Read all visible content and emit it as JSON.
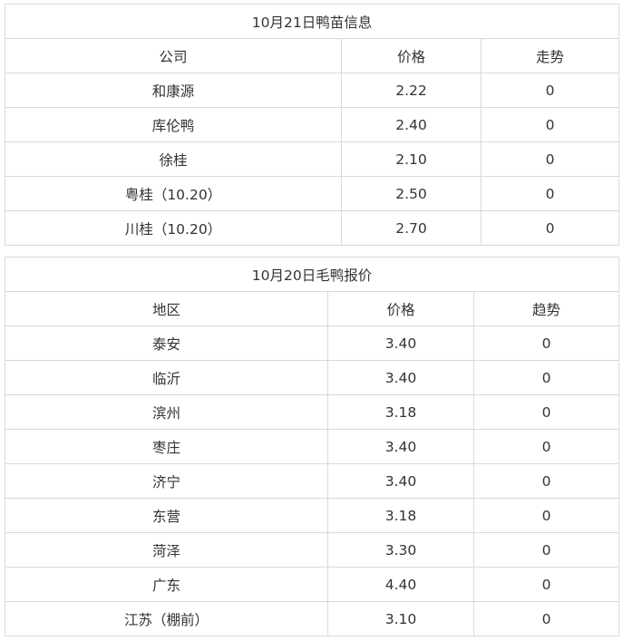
{
  "duckling_table": {
    "title": "10月21日鸭苗信息",
    "headers": [
      "公司",
      "价格",
      "走势"
    ],
    "rows": [
      [
        "和康源",
        "2.22",
        "0"
      ],
      [
        "库伦鸭",
        "2.40",
        "0"
      ],
      [
        "徐桂",
        "2.10",
        "0"
      ],
      [
        "粤桂（10.20）",
        "2.50",
        "0"
      ],
      [
        "川桂（10.20）",
        "2.70",
        "0"
      ]
    ]
  },
  "meat_duck_table": {
    "title": "10月20日毛鸭报价",
    "headers": [
      "地区",
      "价格",
      "趋势"
    ],
    "rows": [
      [
        "泰安",
        "3.40",
        "0"
      ],
      [
        "临沂",
        "3.40",
        "0"
      ],
      [
        "滨州",
        "3.18",
        "0"
      ],
      [
        "枣庄",
        "3.40",
        "0"
      ],
      [
        "济宁",
        "3.40",
        "0"
      ],
      [
        "东营",
        "3.18",
        "0"
      ],
      [
        "菏泽",
        "3.30",
        "0"
      ],
      [
        "广东",
        "4.40",
        "0"
      ],
      [
        "江苏（棚前）",
        "3.10",
        "0"
      ]
    ]
  }
}
